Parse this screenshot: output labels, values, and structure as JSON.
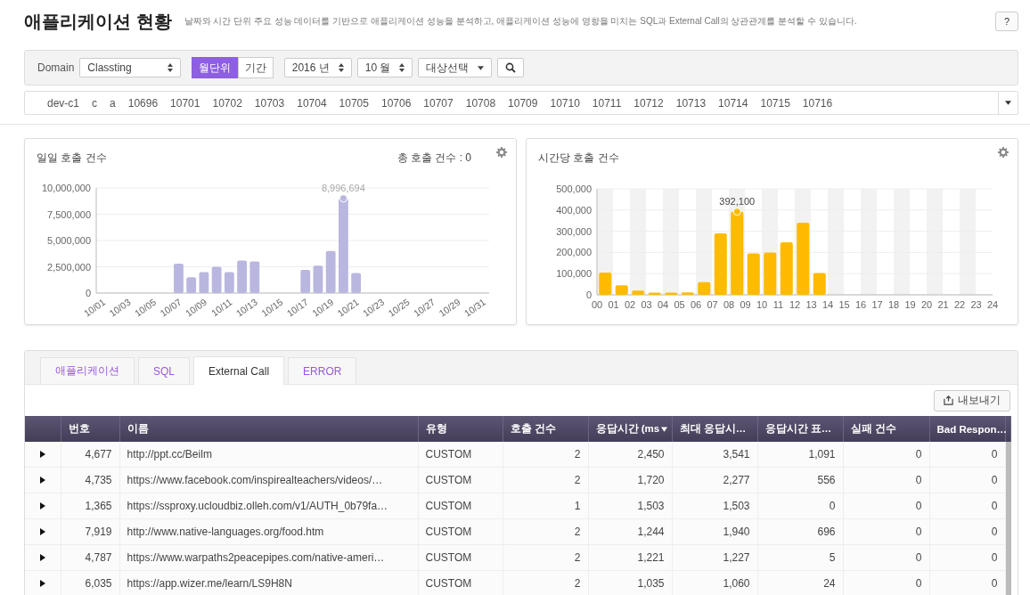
{
  "header": {
    "title": "애플리케이션 현황",
    "description": "날짜와 시간 단위 주요 성능 데이터를 기반으로 애플리케이션 성능을 분석하고, 애플리케이션 성능에 영향을 미치는 SQL과 External Call의 상관관계를 분석할 수 있습니다.",
    "help": "?"
  },
  "toolbar": {
    "domain_label": "Domain",
    "domain": "Classting",
    "period_toggle": [
      {
        "label": "월단위",
        "selected": true
      },
      {
        "label": "기간",
        "selected": false
      }
    ],
    "year": "2016 년",
    "month": "10 월",
    "target": "대상선택"
  },
  "tags": [
    "dev-c1",
    "c",
    "a",
    "10696",
    "10701",
    "10702",
    "10703",
    "10704",
    "10705",
    "10706",
    "10707",
    "10708",
    "10709",
    "10710",
    "10711",
    "10712",
    "10713",
    "10714",
    "10715",
    "10716"
  ],
  "daily_card": {
    "title": "일일 호출 건수",
    "total": "총 호출 건수 : 0",
    "chart_data": {
      "type": "bar",
      "grid": true,
      "categories": [
        "10/01",
        null,
        "10/03",
        null,
        "10/05",
        null,
        "10/07",
        null,
        "10/09",
        null,
        "10/11",
        null,
        "10/13",
        null,
        "10/15",
        null,
        "10/17",
        null,
        "10/19",
        null,
        "10/21",
        null,
        "10/23",
        null,
        "10/25",
        null,
        "10/27",
        null,
        "10/29",
        null,
        "10/31"
      ],
      "series": [
        {
          "color": "#b9b7e0",
          "values": [
            null,
            null,
            null,
            null,
            null,
            null,
            2800000,
            1500000,
            2000000,
            2500000,
            2000000,
            3100000,
            3000000,
            null,
            null,
            null,
            2200000,
            2600000,
            4000000,
            8996694,
            1900000,
            null,
            null,
            null,
            null,
            null,
            null,
            null,
            null,
            null,
            null
          ]
        }
      ],
      "ylim": [
        0,
        10000000
      ],
      "yticks": [
        {
          "value": 0,
          "label": "0"
        },
        {
          "value": 2500000,
          "label": "2,500,000"
        },
        {
          "value": 5000000,
          "label": "5,000,000"
        },
        {
          "value": 7500000,
          "label": "7,500,000"
        },
        {
          "value": 10000000,
          "label": "10,000,000"
        }
      ],
      "annotations": [
        {
          "y": 8996694,
          "text": "8,996,694"
        }
      ]
    }
  },
  "hourly_card": {
    "title": "시간당 호출 건수",
    "chart_data": {
      "type": "bar",
      "grid": true,
      "categories": [
        "00",
        "01",
        "02",
        "03",
        "04",
        "05",
        "06",
        "07",
        "08",
        "09",
        "10",
        "11",
        "12",
        "13",
        "14",
        "15",
        "16",
        "17",
        "18",
        "19",
        "20",
        "21",
        "22",
        "23",
        "24"
      ],
      "series": [
        {
          "color": "#ffbb00",
          "values": [
            105000,
            45000,
            20000,
            10000,
            10000,
            12000,
            60000,
            290000,
            392100,
            195000,
            200000,
            248000,
            340000,
            103000,
            null,
            null,
            null,
            null,
            null,
            null,
            null,
            null,
            null,
            null,
            null
          ]
        }
      ],
      "ylim": [
        0,
        500000
      ],
      "yticks": [
        {
          "value": 0,
          "label": "0"
        },
        {
          "value": 100000,
          "label": "100,000"
        },
        {
          "value": 200000,
          "label": "200,000"
        },
        {
          "value": 300000,
          "label": "300,000"
        },
        {
          "value": 400000,
          "label": "400,000"
        },
        {
          "value": 500000,
          "label": "500,000"
        }
      ],
      "annotations": [
        {
          "y": 392100,
          "text": "392,100"
        }
      ]
    }
  },
  "tabs": [
    {
      "label": "애플리케이션",
      "selected": false
    },
    {
      "label": "SQL",
      "selected": false
    },
    {
      "label": "External Call",
      "selected": true
    },
    {
      "label": "ERROR",
      "selected": false
    }
  ],
  "export_button": "내보내기",
  "table": {
    "columns": [
      {
        "label": "번호",
        "sorted": false
      },
      {
        "label": "이름",
        "sorted": false
      },
      {
        "label": "유형",
        "sorted": false
      },
      {
        "label": "호출 건수",
        "sorted": false
      },
      {
        "label": "응답시간 (ms",
        "sorted": true
      },
      {
        "label": "최대 응답시…",
        "sorted": false
      },
      {
        "label": "응답시간 표…",
        "sorted": false
      },
      {
        "label": "실패 건수",
        "sorted": false
      },
      {
        "label": "Bad Respon…",
        "sorted": false
      }
    ],
    "rows": [
      {
        "cells": [
          "4,677",
          "http://ppt.cc/Beilm",
          "CUSTOM",
          "2",
          "2,450",
          "3,541",
          "1,091",
          "0",
          "0"
        ]
      },
      {
        "cells": [
          "4,735",
          "https://www.facebook.com/inspirealteachers/videos/…",
          "CUSTOM",
          "2",
          "1,720",
          "2,277",
          "556",
          "0",
          "0"
        ]
      },
      {
        "cells": [
          "1,365",
          "https://ssproxy.ucloudbiz.olleh.com/v1/AUTH_0b79fa…",
          "CUSTOM",
          "1",
          "1,503",
          "1,503",
          "0",
          "0",
          "0"
        ]
      },
      {
        "cells": [
          "7,919",
          "http://www.native-languages.org/food.htm",
          "CUSTOM",
          "2",
          "1,244",
          "1,940",
          "696",
          "0",
          "0"
        ]
      },
      {
        "cells": [
          "4,787",
          "https://www.warpaths2peacepipes.com/native-ameri…",
          "CUSTOM",
          "2",
          "1,221",
          "1,227",
          "5",
          "0",
          "0"
        ]
      },
      {
        "cells": [
          "6,035",
          "https://app.wizer.me/learn/LS9H8N",
          "CUSTOM",
          "2",
          "1,035",
          "1,060",
          "24",
          "0",
          "0"
        ]
      }
    ]
  }
}
